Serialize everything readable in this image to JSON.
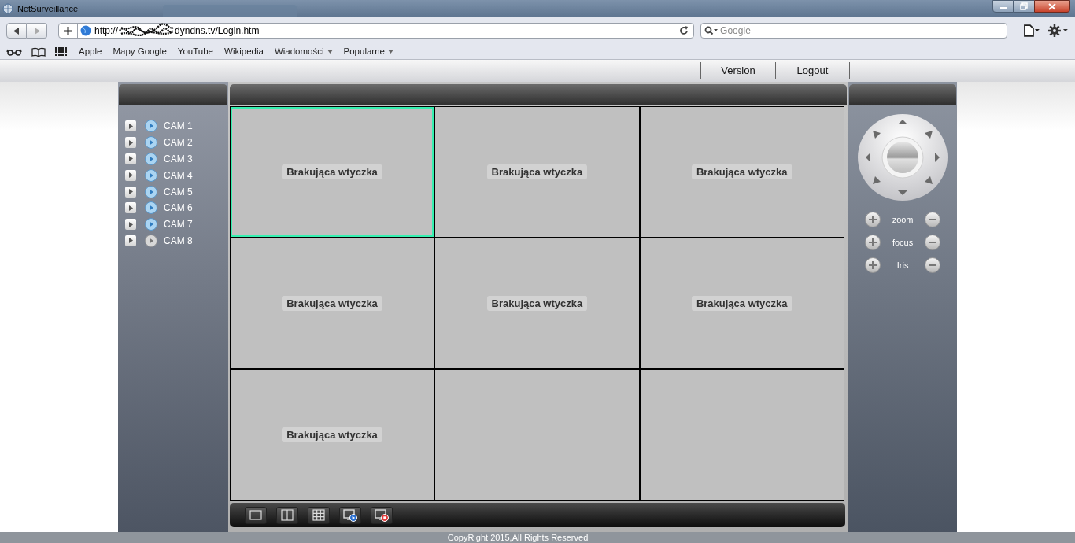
{
  "window": {
    "title": "NetSurveillance"
  },
  "browser": {
    "url_prefix": "http://",
    "url_suffix": "dyndns.tv/Login.htm",
    "search_placeholder": "Google",
    "bookmarks": [
      {
        "label": "Apple",
        "menu": false
      },
      {
        "label": "Mapy Google",
        "menu": false
      },
      {
        "label": "YouTube",
        "menu": false
      },
      {
        "label": "Wikipedia",
        "menu": false
      },
      {
        "label": "Wiadomości",
        "menu": true
      },
      {
        "label": "Popularne",
        "menu": true
      }
    ]
  },
  "top_menu": [
    "Version",
    "Logout"
  ],
  "cameras": [
    {
      "label": "CAM 1",
      "live": true
    },
    {
      "label": "CAM 2",
      "live": true
    },
    {
      "label": "CAM 3",
      "live": true
    },
    {
      "label": "CAM 4",
      "live": true
    },
    {
      "label": "CAM 5",
      "live": true
    },
    {
      "label": "CAM 6",
      "live": true
    },
    {
      "label": "CAM 7",
      "live": true
    },
    {
      "label": "CAM 8",
      "live": false
    }
  ],
  "video_cells": [
    {
      "text": "Brakująca wtyczka",
      "selected": true
    },
    {
      "text": "Brakująca wtyczka",
      "selected": false
    },
    {
      "text": "Brakująca wtyczka",
      "selected": false
    },
    {
      "text": "Brakująca wtyczka",
      "selected": false
    },
    {
      "text": "Brakująca wtyczka",
      "selected": false
    },
    {
      "text": "Brakująca wtyczka",
      "selected": false
    },
    {
      "text": "Brakująca wtyczka",
      "selected": false
    },
    {
      "selected": false
    },
    {
      "selected": false
    }
  ],
  "ptz_controls": [
    "zoom",
    "focus",
    "Iris"
  ],
  "footer": "CopyRight 2015,All Rights Reserved"
}
